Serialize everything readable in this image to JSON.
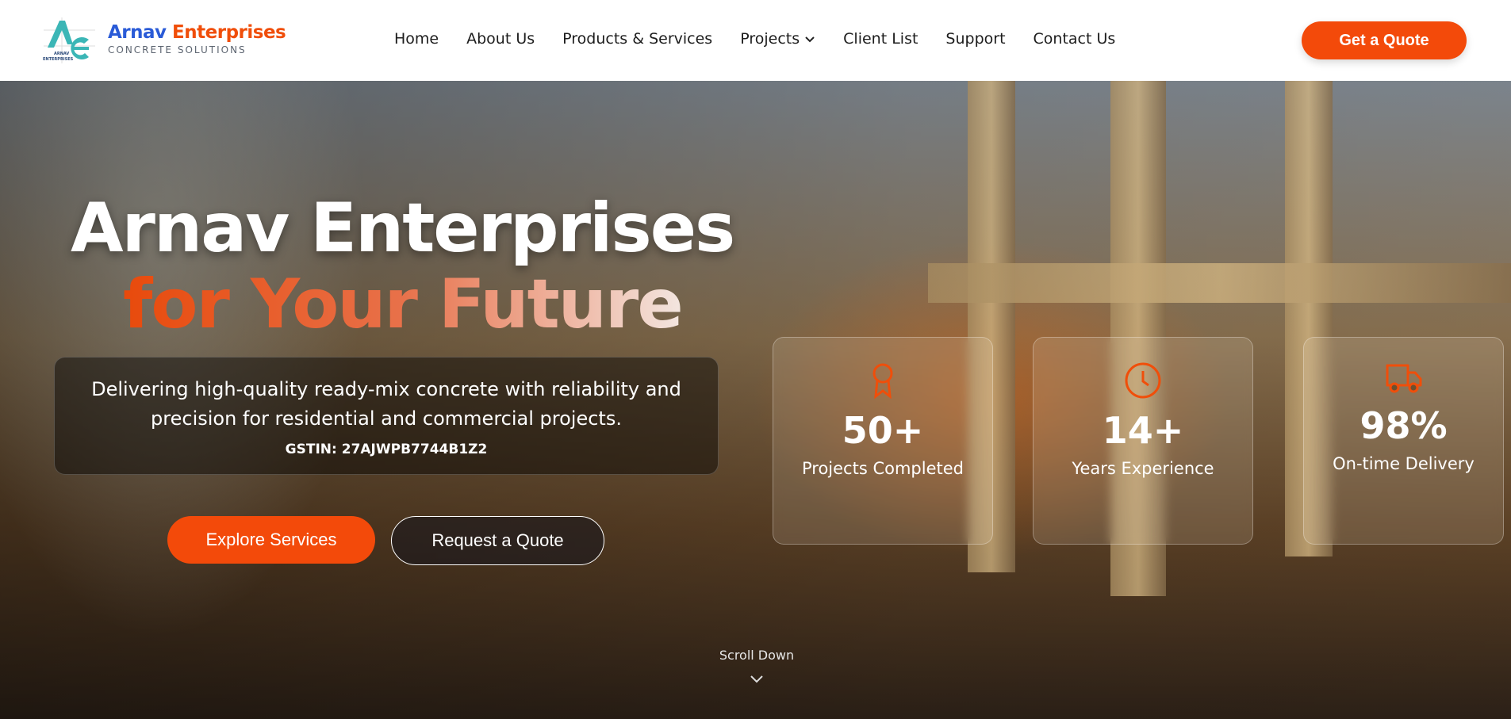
{
  "nav": {
    "logo_text": "ARNAV ENTERPRISES",
    "brand_first": "Arnav",
    "brand_second": "Enterprises",
    "brand_tagline": "CONCRETE SOLUTIONS",
    "items": [
      "Home",
      "About Us",
      "Products & Services",
      "Projects",
      "Client List",
      "Support",
      "Contact Us"
    ],
    "cta": "Get a Quote"
  },
  "hero": {
    "title_line1": "Arnav Enterprises",
    "title_line2": "for Your Future",
    "description": "Delivering high-quality ready-mix concrete with reliability and precision for residential and commercial projects.",
    "gstin": "GSTIN: 27AJWPB7744B1Z2",
    "primary_button": "Explore Services",
    "secondary_button": "Request a Quote",
    "scroll_label": "Scroll Down"
  },
  "stats": [
    {
      "icon": "award-icon",
      "value": "50+",
      "label": "Projects Completed"
    },
    {
      "icon": "clock-icon",
      "value": "14+",
      "label": "Years Experience"
    },
    {
      "icon": "truck-icon",
      "value": "98%",
      "label": "On-time Delivery"
    }
  ],
  "colors": {
    "accent": "#f34a0a",
    "brand_blue": "#2a5bd7"
  }
}
